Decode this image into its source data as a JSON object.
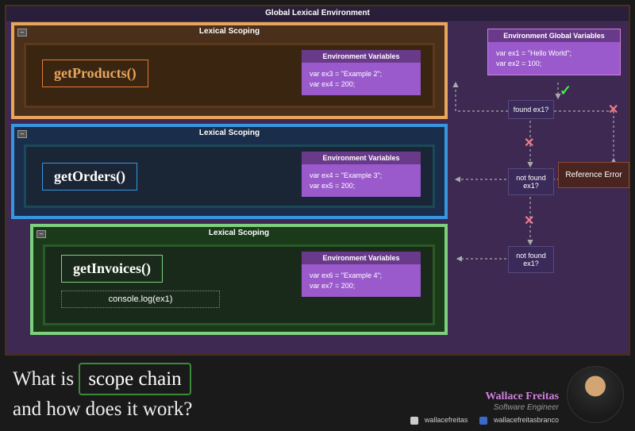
{
  "title": "Global Lexical Environment",
  "scopes": [
    {
      "title": "Lexical Scoping",
      "fn": "getProducts()",
      "env_header": "Environment Variables",
      "vars": [
        "var ex3 = \"Example 2\";",
        "var ex4 = 200;"
      ]
    },
    {
      "title": "Lexical Scoping",
      "fn": "getOrders()",
      "env_header": "Environment Variables",
      "vars": [
        "var ex4 = \"Example 3\";",
        "var ex5 = 200;"
      ]
    },
    {
      "title": "Lexical Scoping",
      "fn": "getInvoices()",
      "log": "console.log(ex1)",
      "env_header": "Environment Variables",
      "vars": [
        "var ex6 = \"Example 4\";",
        "var ex7 = 200;"
      ]
    }
  ],
  "global_vars": {
    "header": "Environment Global Variables",
    "vars": [
      "var ex1 = \"Hello World\";",
      "var ex2 = 100;"
    ]
  },
  "flow": {
    "found": "found ex1?",
    "not_found": "not found ex1?",
    "error": "Reference Error"
  },
  "question": {
    "l1": "What is",
    "hl": "scope chain",
    "l2": "and how does it work?"
  },
  "author": {
    "name": "Wallace Freitas",
    "role": "Software Engineer",
    "gh": "wallacefreitas",
    "li": "wallacefreitasbranco"
  }
}
